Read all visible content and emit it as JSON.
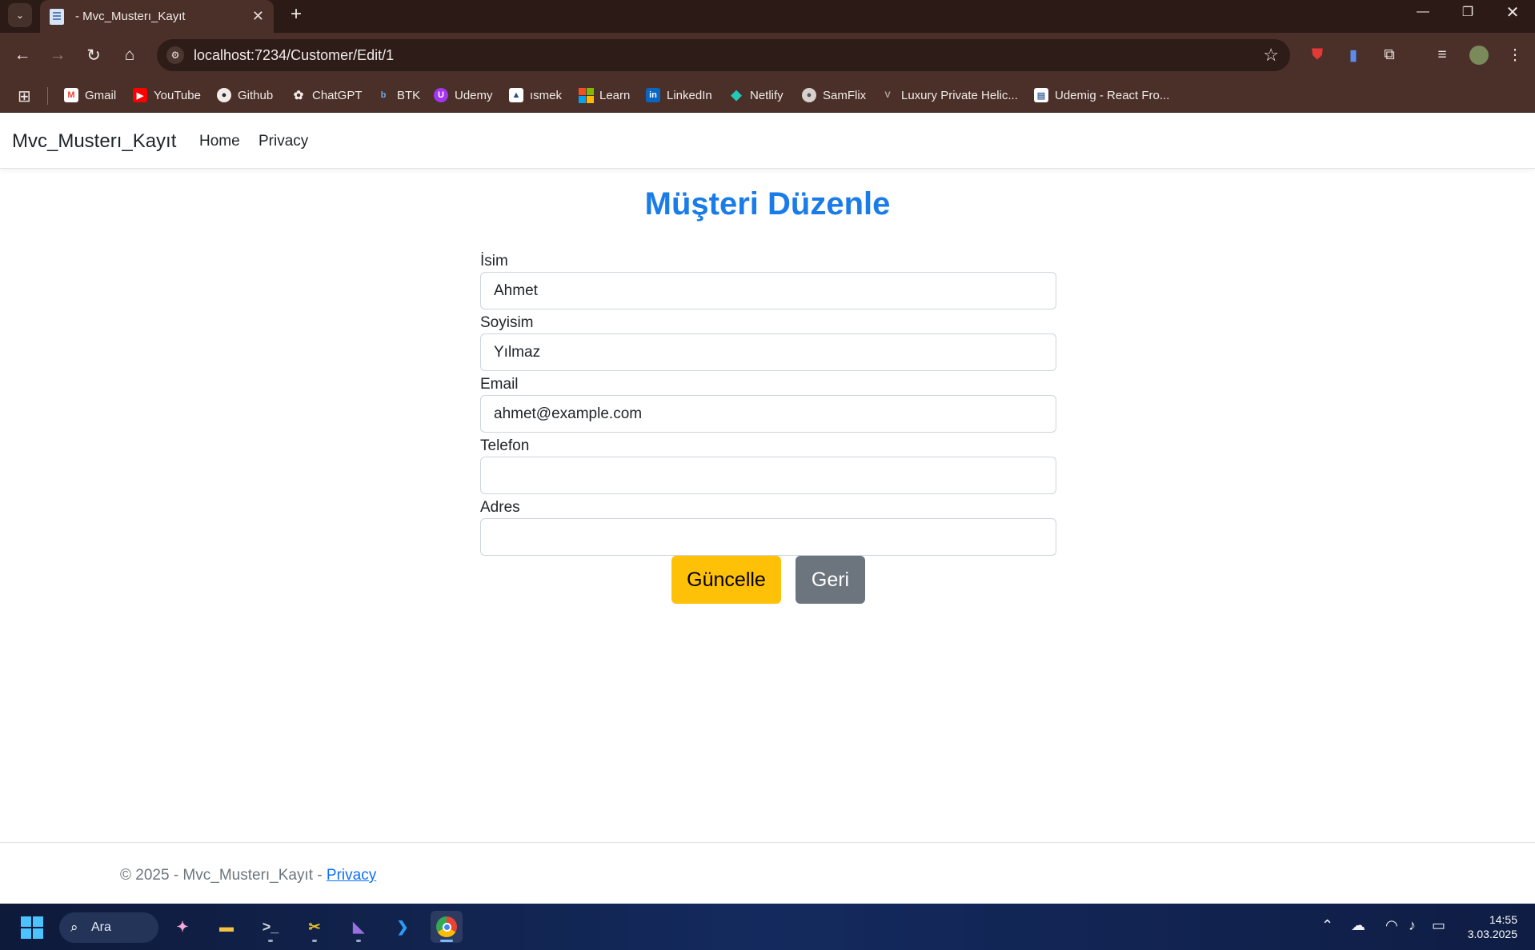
{
  "browser": {
    "tab_title": "- Mvc_Musterı_Kayıt",
    "url": "localhost:7234/Customer/Edit/1"
  },
  "bookmarks": [
    {
      "label": "Gmail",
      "icon": "gmail-icon",
      "color": "#ea4335",
      "glyph": "M"
    },
    {
      "label": "YouTube",
      "icon": "youtube-icon",
      "color": "#ff0000",
      "glyph": "▶"
    },
    {
      "label": "Github",
      "icon": "github-icon",
      "color": "#24292f",
      "glyph": "◉"
    },
    {
      "label": "ChatGPT",
      "icon": "chatgpt-icon",
      "color": "#5a5a5a",
      "glyph": "✿"
    },
    {
      "label": "BTK",
      "icon": "btk-icon",
      "color": "#2b6cb0",
      "glyph": "b"
    },
    {
      "label": "Udemy",
      "icon": "udemy-icon",
      "color": "#a435f0",
      "glyph": "U"
    },
    {
      "label": "ısmek",
      "icon": "ismek-icon",
      "color": "#1f4e8c",
      "glyph": "▲"
    },
    {
      "label": "Learn",
      "icon": "microsoft-learn-icon",
      "color": "#f25022",
      "glyph": "■"
    },
    {
      "label": "LinkedIn",
      "icon": "linkedin-icon",
      "color": "#0a66c2",
      "glyph": "in"
    },
    {
      "label": "Netlify",
      "icon": "netlify-icon",
      "color": "#25c7b7",
      "glyph": "◆"
    },
    {
      "label": "SamFlix",
      "icon": "samflix-icon",
      "color": "#777777",
      "glyph": "●"
    },
    {
      "label": "Luxury Private Helic...",
      "icon": "helicopter-icon",
      "color": "#8a7a70",
      "glyph": "V"
    },
    {
      "label": "Udemig - React Fro...",
      "icon": "udemig-icon",
      "color": "#4a6fa5",
      "glyph": "▤"
    }
  ],
  "site": {
    "brand": "Mvc_Musterı_Kayıt",
    "nav": [
      "Home",
      "Privacy"
    ]
  },
  "form": {
    "title": "Müşteri Düzenle",
    "fields": [
      {
        "label": "İsim",
        "value": "Ahmet"
      },
      {
        "label": "Soyisim",
        "value": "Yılmaz"
      },
      {
        "label": "Email",
        "value": "ahmet@example.com"
      },
      {
        "label": "Telefon",
        "value": ""
      },
      {
        "label": "Adres",
        "value": ""
      }
    ],
    "update_button": "Güncelle",
    "back_button": "Geri",
    "update_color": "#ffc107",
    "back_color": "#6c757d",
    "title_color": "#1a7ce8"
  },
  "footer": {
    "text": "© 2025 - Mvc_Musterı_Kayıt - ",
    "link": "Privacy"
  },
  "taskbar": {
    "search_label": "Ara",
    "time": "14:55",
    "date": "3.03.2025"
  }
}
